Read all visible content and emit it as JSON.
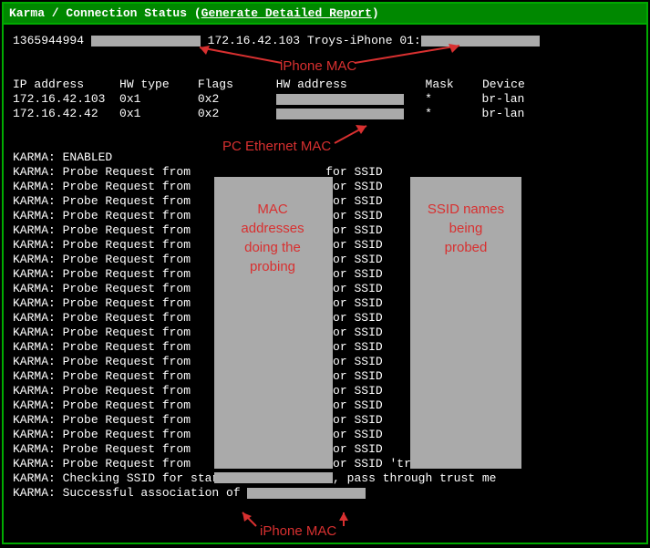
{
  "header": {
    "title_left": "Karma / Connection Status",
    "link_text": "Generate Detailed Report"
  },
  "top_line": {
    "timestamp": "1365944994",
    "ip": "172.16.42.103",
    "hostname": "Troys-iPhone",
    "suffix": "01:"
  },
  "table": {
    "headers": {
      "ip": "IP address",
      "hw_type": "HW type",
      "flags": "Flags",
      "hw_addr": "HW address",
      "mask": "Mask",
      "device": "Device"
    },
    "rows": [
      {
        "ip": "172.16.42.103",
        "hw_type": "0x1",
        "flags": "0x2",
        "mask": "*",
        "device": "br-lan"
      },
      {
        "ip": "172.16.42.42",
        "hw_type": "0x1",
        "flags": "0x2",
        "mask": "*",
        "device": "br-lan"
      }
    ]
  },
  "karma": {
    "enabled": "KARMA: ENABLED",
    "probe_prefix": "KARMA: Probe Request from",
    "for_ssid": "for SSID",
    "last_ssid": "'trust me'",
    "checking": "KARMA: Checking SSID for start of association, pass through trust me",
    "success": "KARMA: Successful association of",
    "probe_count": 21
  },
  "annotations": {
    "iphone_mac_top": "iPhone MAC",
    "pc_mac": "PC Ethernet MAC",
    "mac_probing": "MAC\naddresses\ndoing the\nprobing",
    "ssid_probed": "SSID names\nbeing\nprobed",
    "iphone_mac_bottom": "iPhone MAC"
  }
}
